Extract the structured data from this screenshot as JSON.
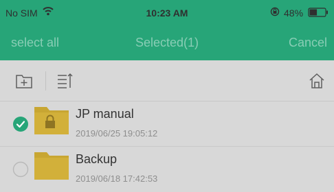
{
  "status_bar": {
    "carrier": "No SIM",
    "time": "10:23 AM",
    "battery": "48%",
    "battery_level": 0.48
  },
  "nav": {
    "left_label": "select all",
    "title": "Selected(1)",
    "right_label": "Cancel"
  },
  "toolbar": {
    "icons": [
      "new-folder-icon",
      "sort-icon",
      "home-icon"
    ]
  },
  "files": [
    {
      "name": "JP manual",
      "date": "2019/06/25 19:05:12",
      "selected": true,
      "locked": true
    },
    {
      "name": "Backup",
      "date": "2019/06/18 17:42:53",
      "selected": false,
      "locked": false
    }
  ],
  "colors": {
    "header": "#27a578",
    "check": "#27a578",
    "folder": "#c8a632",
    "background": "#d8d8d8"
  }
}
